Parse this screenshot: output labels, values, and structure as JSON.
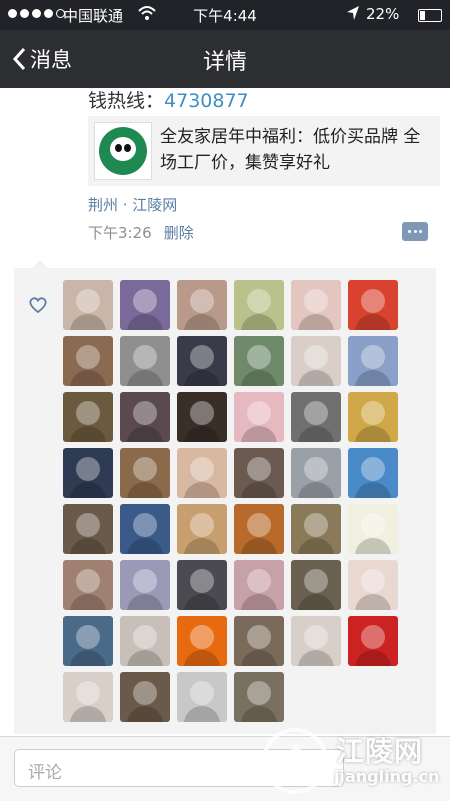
{
  "status_bar": {
    "carrier": "中国联通",
    "time": "下午4:44",
    "battery": "22%"
  },
  "nav": {
    "back_label": "消息",
    "title": "详情"
  },
  "post": {
    "hotline_label": "钱热线：",
    "hotline_number": "4730877",
    "link_card_text": "全友家居年中福利：低价买品牌 全场工厂价，集赞享好礼",
    "source": "荆州 · 江陵网",
    "time": "下午3:26",
    "delete_label": "删除"
  },
  "likes": {
    "avatar_colors": [
      "#c9b6a8",
      "#7a6a9a",
      "#b99a8a",
      "#b8c28a",
      "#e3c6c0",
      "#d8422e",
      "#8a6b52",
      "#8f8f8f",
      "#3a3a4a",
      "#6e8a6a",
      "#d9cfc8",
      "#8aa0c8",
      "#6b5a3e",
      "#5a4a50",
      "#3a2e28",
      "#e6b8c0",
      "#707070",
      "#d0a848",
      "#2f3b52",
      "#8a6a4a",
      "#d8b8a0",
      "#6a5a50",
      "#9aa0a8",
      "#4a8ac8",
      "#6a5a4a",
      "#3a5a8a",
      "#c8a070",
      "#b86a2a",
      "#8a7a5a",
      "#f0f0e0",
      "#a08070",
      "#9a9ab8",
      "#4a4a50",
      "#c8a0a8",
      "#6a6050",
      "#e8d8d0",
      "#4a6a8a",
      "#c8c0b8",
      "#e86a10",
      "#7a6a5a",
      "#d8d0c8",
      "#cc2222",
      "#d8d0c8",
      "#6a5a4a",
      "#c8c8c8",
      "#7a7060"
    ]
  },
  "comment": {
    "placeholder": "评论"
  },
  "watermark": {
    "name": "江陵网",
    "domain": "jiangling.cn"
  }
}
